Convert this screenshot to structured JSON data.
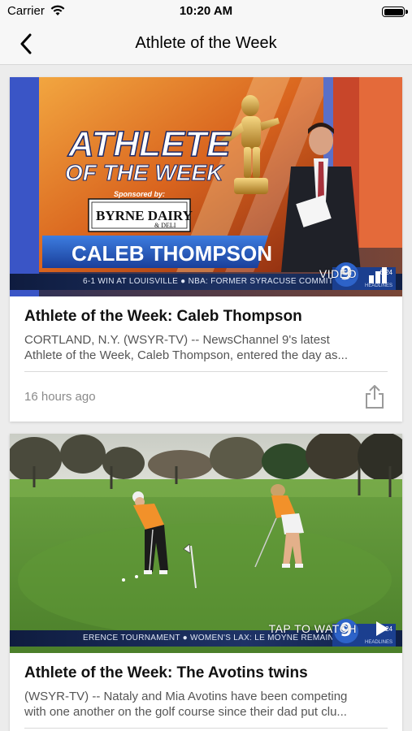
{
  "status_bar": {
    "carrier": "Carrier",
    "time": "10:20 AM",
    "battery_level": 1.0
  },
  "nav": {
    "title": "Athlete of the Week",
    "back_icon": "chevron-left-icon"
  },
  "articles": [
    {
      "title": "Athlete of the Week: Caleb Thompson",
      "snippet_lines": [
        "CORTLAND, N.Y. (WSYR-TV) -- NewsChannel 9's latest",
        "Athlete of the Week, Caleb Thompson, entered the day as..."
      ],
      "timestamp": "16 hours ago",
      "media_label": "VIDEO",
      "media_icon": "bar-chart-icon",
      "share_icon": "share-icon",
      "image": {
        "graphic_title_line1": "ATHLETE",
        "graphic_title_line2": "OF THE WEEK",
        "sponsor_label": "Sponsored by:",
        "sponsor_name": "BYRNE DAIRY",
        "sponsor_sub": "& DELI",
        "lower_third": "CALEB THOMPSON",
        "ticker": "6-1 WIN AT LOUISVILLE  ●  NBA: FORMER SYRACUSE COMMIT DA",
        "bug_number": "9",
        "bug_time": "6:24",
        "bug_label": "HEADLINES"
      }
    },
    {
      "title": "Athlete of the Week: The Avotins twins",
      "snippet_lines": [
        "(WSYR-TV) -- Nataly and Mia Avotins have been competing",
        "with one another on the golf course since their dad put clu..."
      ],
      "media_label": "TAP TO WATCH",
      "media_icon": "play-icon",
      "image": {
        "ticker": "ERENCE TOURNAMENT  ●  WOMEN'S LAX: LE MOYNE REMAINS UN",
        "bug_number": "9",
        "bug_time": "6:24",
        "bug_label": "HEADLINES"
      }
    }
  ],
  "colors": {
    "background": "#ececec",
    "nav_background": "#f7f7f7",
    "card_background": "#ffffff",
    "muted_text": "#8a8a8a"
  }
}
